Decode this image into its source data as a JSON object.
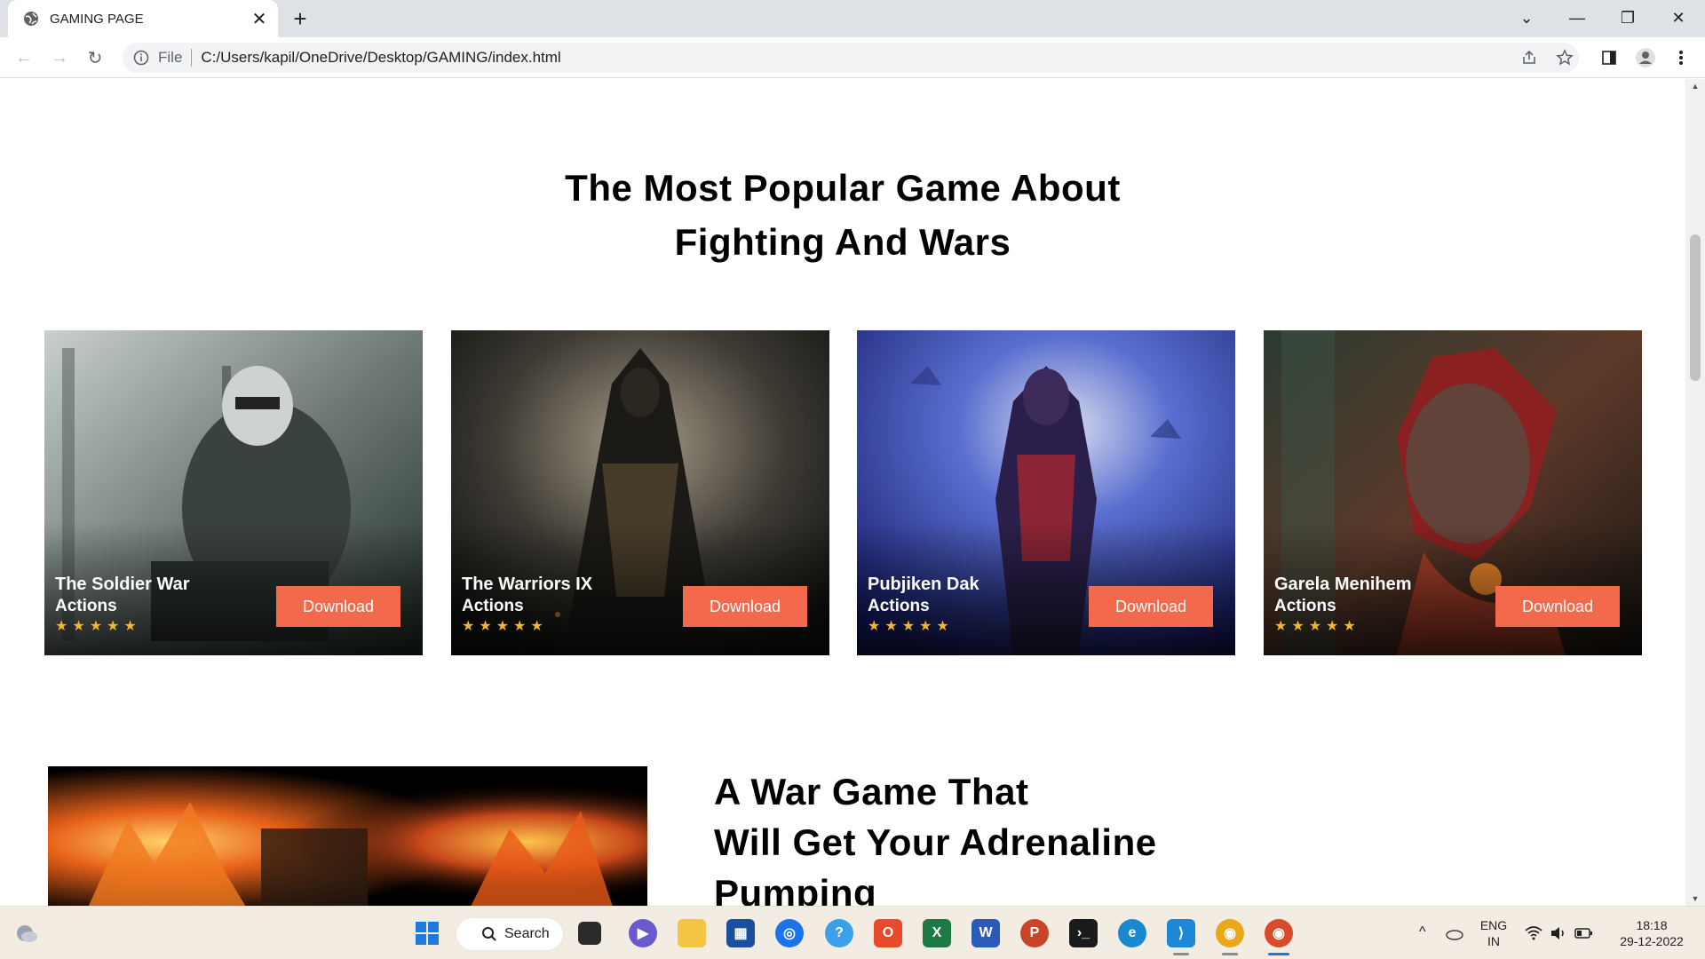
{
  "browser": {
    "tab_title": "GAMING PAGE",
    "omnibox_file_label": "File",
    "omnibox_url": "C:/Users/kapil/OneDrive/Desktop/GAMING/index.html"
  },
  "page": {
    "title_line1": "The Most Popular Game About",
    "title_line2": "Fighting And Wars",
    "cards": [
      {
        "name": "The Soldier War",
        "genre": "Actions",
        "stars": "★★★★★",
        "button": "Download"
      },
      {
        "name": "The Warriors IX",
        "genre": "Actions",
        "stars": "★★★★★",
        "button": "Download"
      },
      {
        "name": "Pubjiken Dak",
        "genre": "Actions",
        "stars": "★★★★★",
        "button": "Download"
      },
      {
        "name": "Garela Menihem",
        "genre": "Actions",
        "stars": "★★★★★",
        "button": "Download"
      }
    ],
    "promo_line1": "A War Game That",
    "promo_line2": "Will Get Your Adrenaline",
    "promo_line3": "Pumping"
  },
  "taskbar": {
    "search_label": "Search",
    "lang_line1": "ENG",
    "lang_line2": "IN",
    "time": "18:18",
    "date": "29-12-2022"
  },
  "colors": {
    "accent_button": "#f26a4b",
    "star": "#f5b52e"
  }
}
